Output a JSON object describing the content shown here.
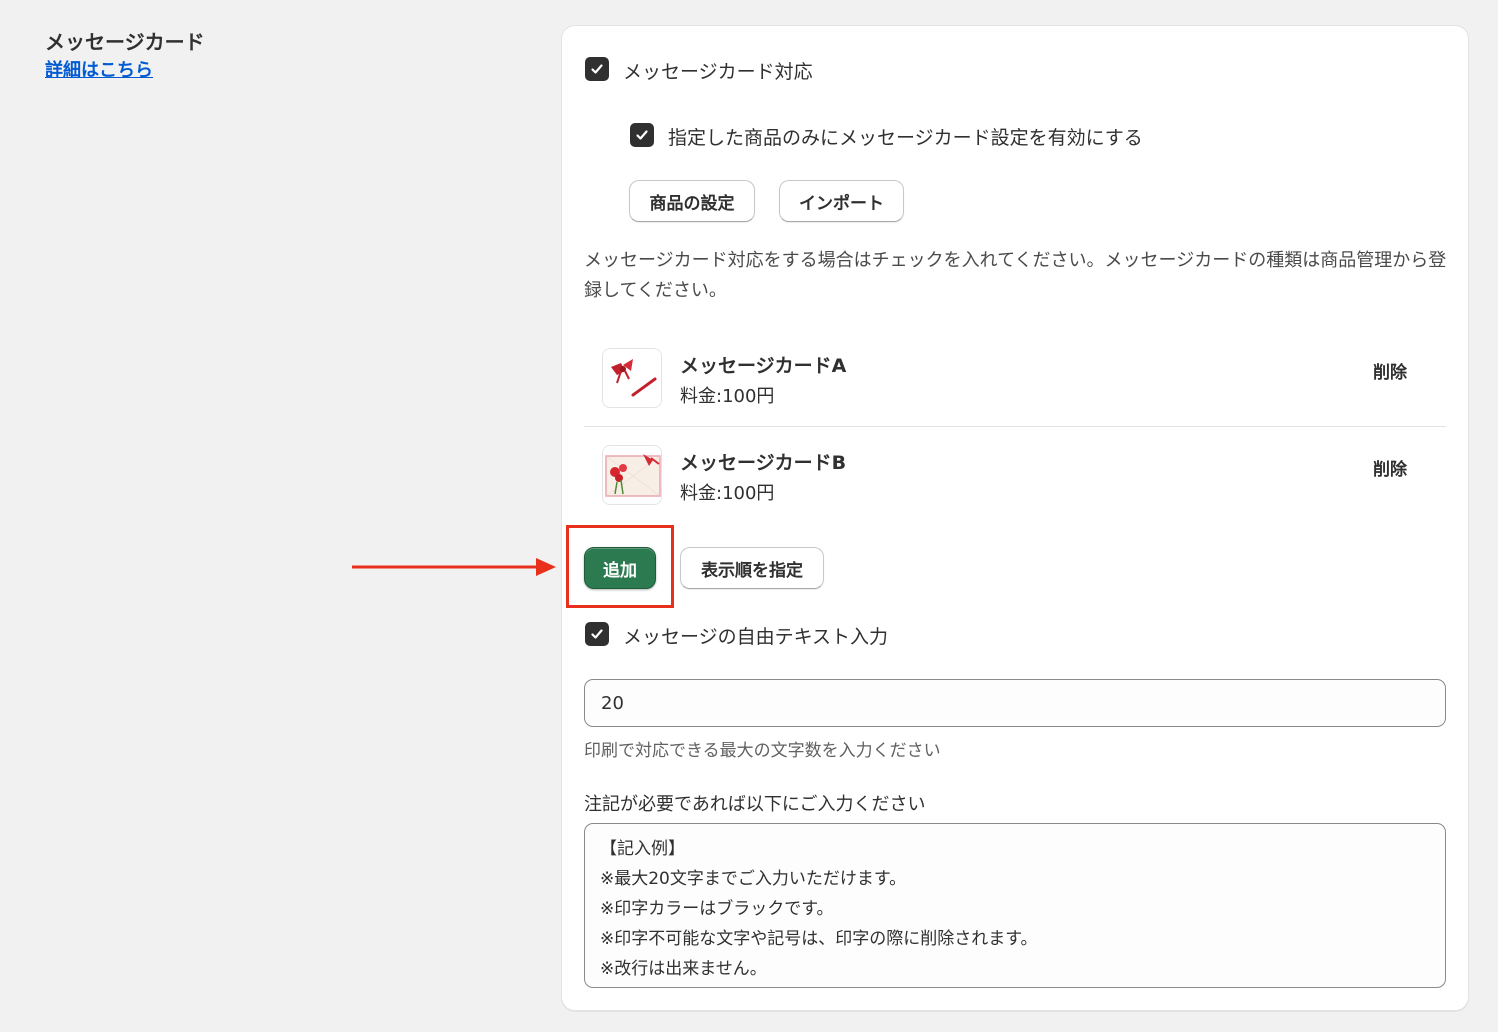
{
  "section": {
    "title": "メッセージカード",
    "detail_link": "詳細はこちら"
  },
  "settings": {
    "message_card_enabled": {
      "label": "メッセージカード対応",
      "checked": true
    },
    "specified_products_only": {
      "label": "指定した商品のみにメッセージカード設定を有効にする",
      "checked": true
    },
    "product_settings_button": "商品の設定",
    "import_button": "インポート",
    "help_text": "メッセージカード対応をする場合はチェックを入れてください。メッセージカードの種類は商品管理から登録してください。"
  },
  "cards": [
    {
      "name": "メッセージカードA",
      "price": "料金:100円",
      "delete_label": "削除",
      "thumb_icon": "ribbon-card-image"
    },
    {
      "name": "メッセージカードB",
      "price": "料金:100円",
      "delete_label": "削除",
      "thumb_icon": "flower-card-image"
    }
  ],
  "actions": {
    "add_button": "追加",
    "sort_button": "表示順を指定"
  },
  "free_text": {
    "checkbox_label": "メッセージの自由テキスト入力",
    "checked": true,
    "max_chars_value": "20",
    "max_chars_help": "印刷で対応できる最大の文字数を入力ください",
    "note_label": "注記が必要であれば以下にご入力ください",
    "note_value": "【記入例】\n※最大20文字までご入力いただけます。\n※印字カラーはブラックです。\n※印字不可能な文字や記号は、印字の際に削除されます。\n※改行は出来ません。"
  },
  "colors": {
    "primary_button": "#2c7a4f",
    "link": "#005bd3",
    "highlight": "#e8301c"
  }
}
